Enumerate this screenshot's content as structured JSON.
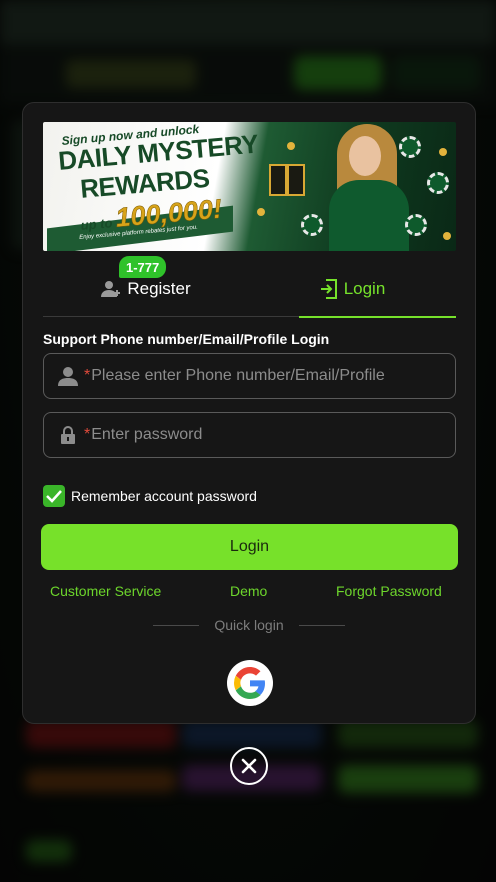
{
  "banner": {
    "line1": "Sign up now and unlock",
    "line2": "DAILY MYSTERY",
    "line3": "REWARDS",
    "prefix": "up to",
    "amount": "100,000!",
    "tagline": "Enjoy exclusive platform rebates just for you."
  },
  "tabs": {
    "register": {
      "label": "Register",
      "badge": "1-777",
      "icon": "add-user-icon"
    },
    "login": {
      "label": "Login",
      "icon": "login-door-icon",
      "active": true
    }
  },
  "form": {
    "support_label": "Support Phone number/Email/Profile Login",
    "account": {
      "required_mark": "*",
      "placeholder": "Please enter Phone number/Email/Profile",
      "icon": "user-icon"
    },
    "password": {
      "required_mark": "*",
      "placeholder": "Enter password",
      "icon": "lock-icon"
    },
    "remember": {
      "label": "Remember account password",
      "checked": true
    }
  },
  "login_button": "Login",
  "links": {
    "customer_service": "Customer Service",
    "demo": "Demo",
    "forgot_password": "Forgot Password"
  },
  "quick_login": {
    "label": "Quick login",
    "providers": [
      "google-icon"
    ]
  },
  "colors": {
    "accent": "#76e22b",
    "button": "#77e12a",
    "badge": "#2fc22a",
    "required": "#e04a3b",
    "modal_bg": "#161616"
  }
}
